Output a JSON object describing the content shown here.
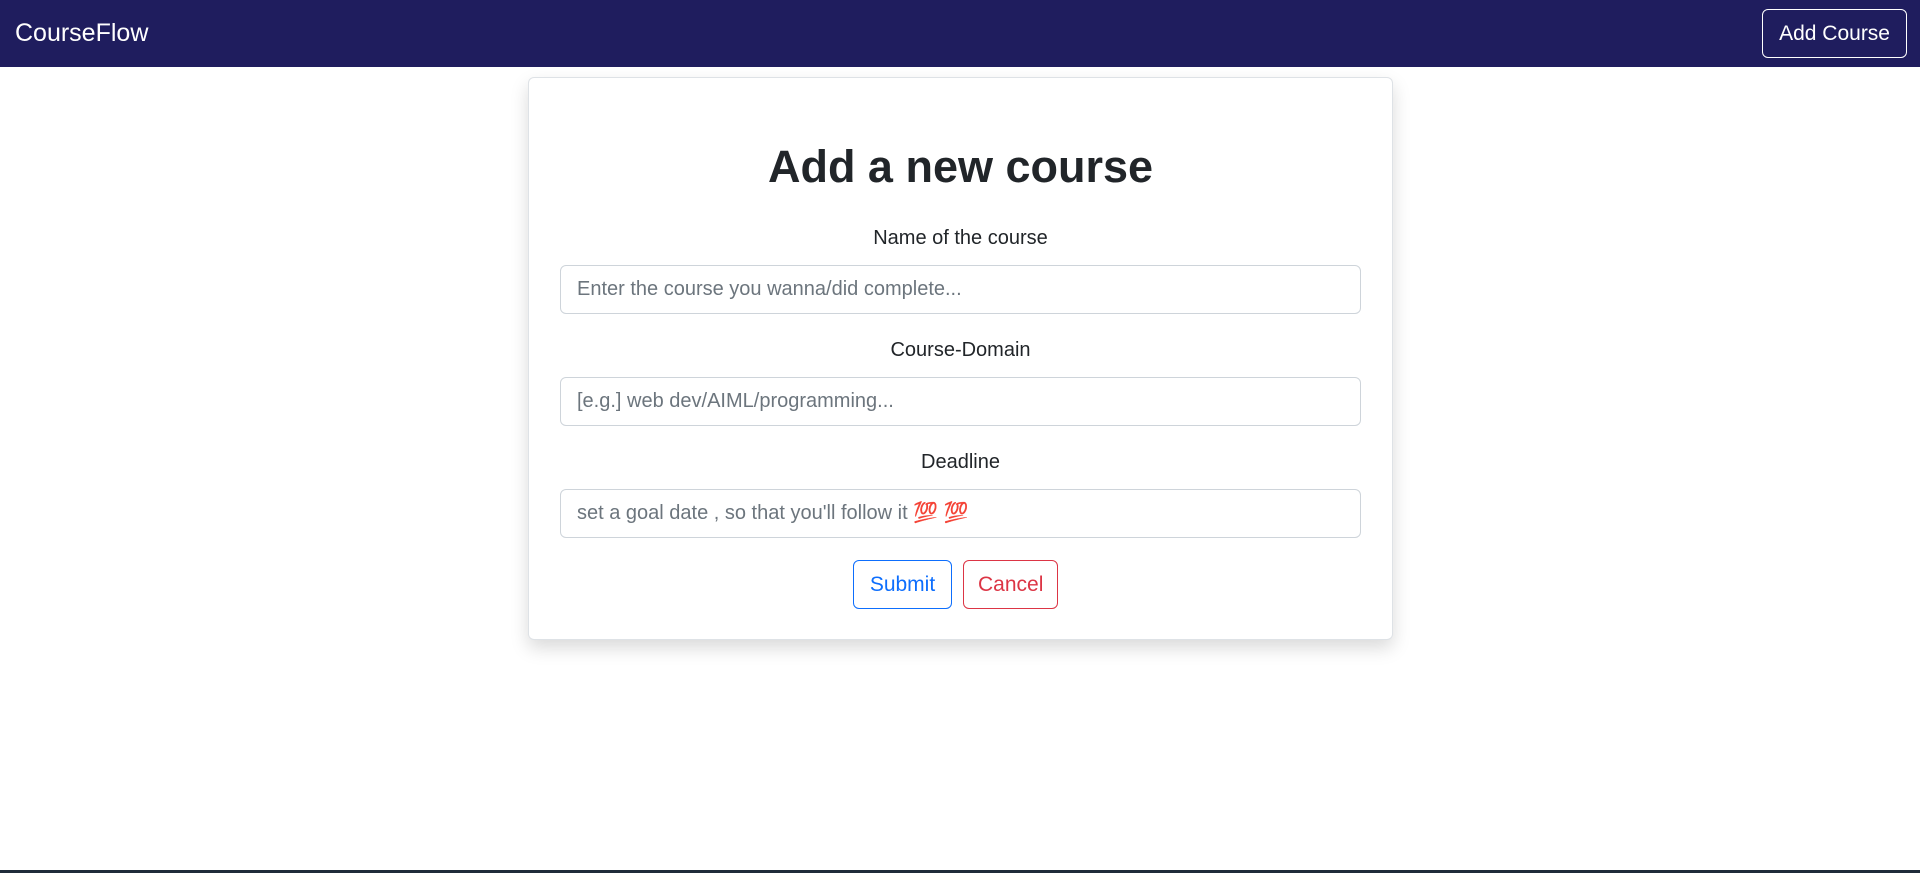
{
  "navbar": {
    "brand": "CourseFlow",
    "add_course_label": "Add Course"
  },
  "form": {
    "title": "Add a new course",
    "course_name": {
      "label": "Name of the course",
      "placeholder": "Enter the course you wanna/did complete...",
      "value": ""
    },
    "course_domain": {
      "label": "Course-Domain",
      "placeholder": "[e.g.] web dev/AIML/programming...",
      "value": ""
    },
    "deadline": {
      "label": "Deadline",
      "placeholder": "set a goal date , so that you'll follow it 💯 💯",
      "value": ""
    },
    "submit_label": "Submit",
    "cancel_label": "Cancel"
  },
  "colors": {
    "navbar_bg": "#1f1d5e",
    "primary": "#0d6efd",
    "danger": "#dc3545"
  }
}
